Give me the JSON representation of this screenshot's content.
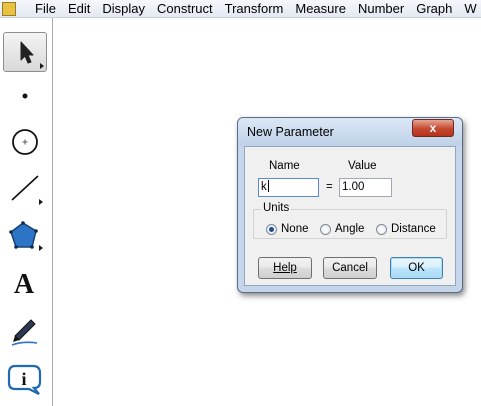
{
  "menubar": {
    "items": [
      "File",
      "Edit",
      "Display",
      "Construct",
      "Transform",
      "Measure",
      "Number",
      "Graph",
      "W"
    ]
  },
  "toolbox": {
    "tools": [
      {
        "name": "arrow-select-tool",
        "icon": "arrow-pointer-icon",
        "selected": true
      },
      {
        "name": "point-tool",
        "icon": "point-icon"
      },
      {
        "name": "compass-tool",
        "icon": "circle-icon"
      },
      {
        "name": "straightedge-tool",
        "icon": "line-segment-icon"
      },
      {
        "name": "polygon-tool",
        "icon": "polygon-icon"
      },
      {
        "name": "text-tool",
        "icon": "letter-a-icon",
        "glyph": "A"
      },
      {
        "name": "marker-tool",
        "icon": "pen-marker-icon"
      },
      {
        "name": "information-tool",
        "icon": "info-icon",
        "glyph": "i"
      }
    ]
  },
  "dialog": {
    "title": "New Parameter",
    "close_glyph": "x",
    "name_label": "Name",
    "value_label": "Value",
    "equals": "=",
    "name_value": "k",
    "value_value": "1.00",
    "units_label": "Units",
    "units_options": [
      "None",
      "Angle",
      "Distance"
    ],
    "units_selected": "None",
    "help_label": "Help",
    "cancel_label": "Cancel",
    "ok_label": "OK"
  },
  "colors": {
    "dialog_frame": "#c5d6ea",
    "close_button": "#c4482f",
    "polygon_fill": "#2e74c6",
    "default_button_border": "#3c7fb1"
  }
}
